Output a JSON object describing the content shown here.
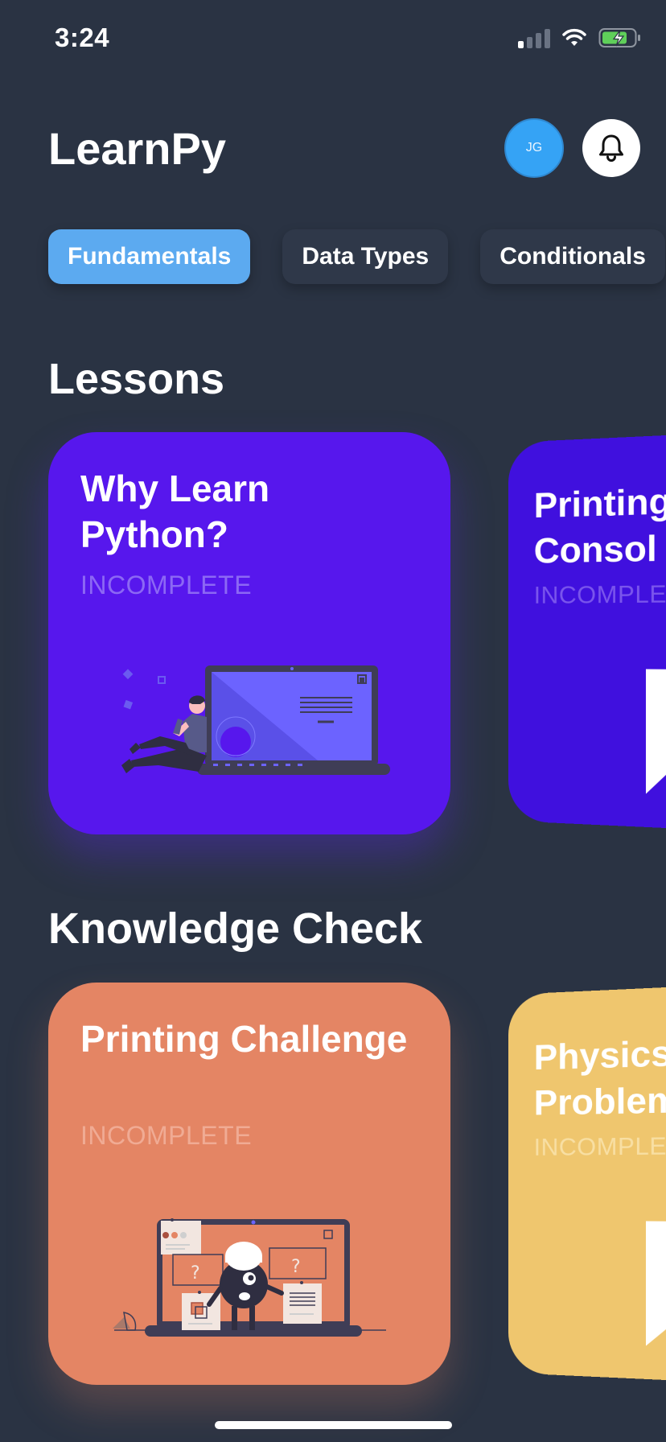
{
  "status_bar": {
    "time": "3:24"
  },
  "header": {
    "app_title": "LearnPy",
    "avatar_initials": "JG"
  },
  "categories": [
    {
      "label": "Fundamentals",
      "active": true
    },
    {
      "label": "Data Types",
      "active": false
    },
    {
      "label": "Conditionals",
      "active": false
    }
  ],
  "lessons": {
    "title": "Lessons",
    "cards": [
      {
        "title": "Why Learn Python?",
        "status": "INCOMPLETE",
        "color": "#5717ed"
      },
      {
        "title": "Printing to Consol",
        "status": "INCOMPLETE",
        "color": "#4010de"
      }
    ]
  },
  "knowledge_check": {
    "title": "Knowledge Check",
    "cards": [
      {
        "title": "Printing Challenge",
        "status": "INCOMPLETE",
        "color": "#e48564"
      },
      {
        "title": "Physics Problem",
        "status": "INCOMPLETE",
        "color": "#efc66e"
      }
    ]
  },
  "accent_color": "#5caaf0",
  "background_color": "#2a3343"
}
